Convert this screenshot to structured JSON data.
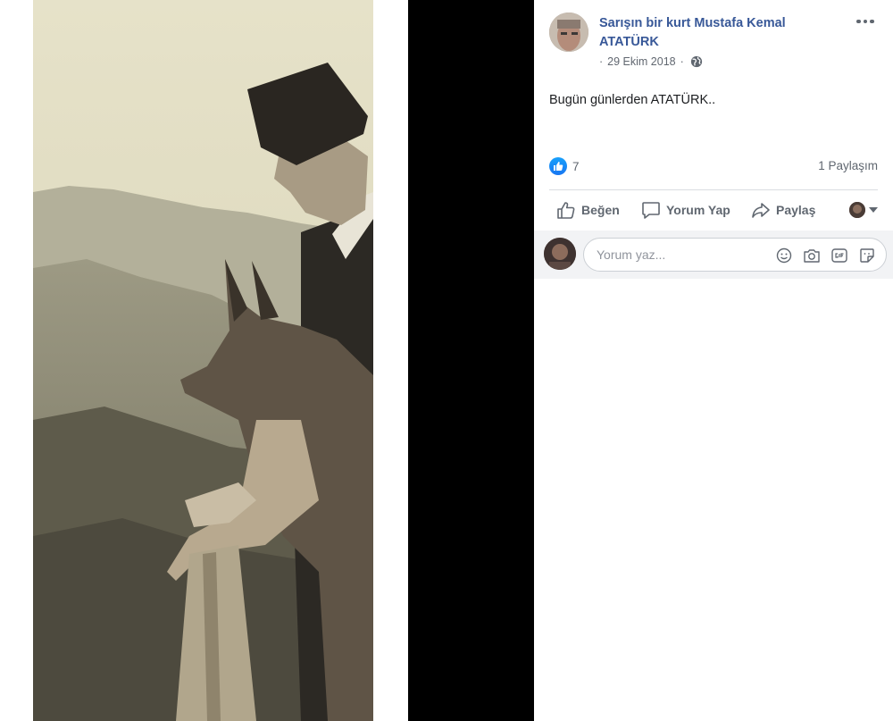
{
  "post": {
    "author": "Sarışın bir kurt Mustafa Kemal ATATÜRK",
    "date": "29 Ekim 2018",
    "date_prefix": "·",
    "date_sep": "·",
    "privacy_icon": "globe-icon",
    "text": "Bugün günlerden ATATÜRK..",
    "like_count": "7",
    "share_count_label": "1 Paylaşım"
  },
  "actions": {
    "like_label": "Beğen",
    "comment_label": "Yorum Yap",
    "share_label": "Paylaş"
  },
  "comment": {
    "placeholder": "Yorum yaz..."
  },
  "colors": {
    "link": "#385898",
    "accent": "#1877f2",
    "muted_text": "#606770",
    "comment_bg": "#f2f3f5"
  }
}
